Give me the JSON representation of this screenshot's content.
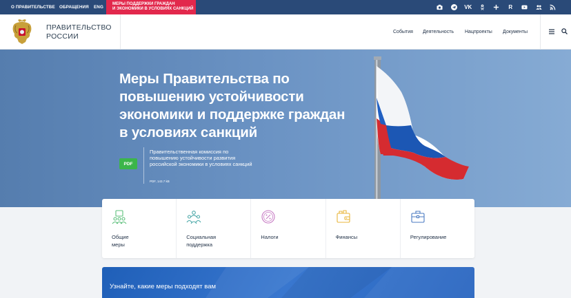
{
  "topbar": {
    "about": "О ПРАВИТЕЛЬСТВЕ",
    "appeals": "ОБРАЩЕНИЯ",
    "eng": "ENG",
    "promo_line1": "МЕРЫ ПОДДЕРЖКИ ГРАЖДАН",
    "promo_line2": "И ЭКОНОМИКИ В УСЛОВИЯХ САНКЦИЙ",
    "socials": [
      "camera-icon",
      "telegram-icon",
      "vk-icon",
      "odnoklassniki-icon",
      "plus-icon",
      "rutube-icon",
      "youtube-icon",
      "people-icon",
      "rss-icon"
    ],
    "vk_text": "VK",
    "r_text": "R"
  },
  "header": {
    "brand_line1": "ПРАВИТЕЛЬСТВО",
    "brand_line2": "РОССИИ",
    "nav": [
      "События",
      "Деятельность",
      "Нацпроекты",
      "Документы"
    ]
  },
  "hero": {
    "title": "Меры Правительства по повышению устойчивости экономики и поддержке граждан в условиях санкций",
    "pdf_label": "PDF",
    "doc_title": "Правительственная комиссия по повышению устойчивости развития российской экономики в условиях санкций",
    "doc_meta": "PDF, 143.7 kB"
  },
  "cards": [
    {
      "label": "Общие\nмеры",
      "icon": "general-measures-icon"
    },
    {
      "label": "Социальная\nподдержка",
      "icon": "social-support-icon"
    },
    {
      "label": "Налоги",
      "icon": "taxes-icon"
    },
    {
      "label": "Финансы",
      "icon": "finance-icon"
    },
    {
      "label": "Регулирование",
      "icon": "regulation-icon"
    }
  ],
  "quiz": {
    "title": "Узнайте, какие меры подходят вам"
  },
  "colors": {
    "topbar": "#2a4a78",
    "promo": "#e2284c",
    "pdf": "#3bb54a",
    "quiz": "#2a66c0"
  }
}
